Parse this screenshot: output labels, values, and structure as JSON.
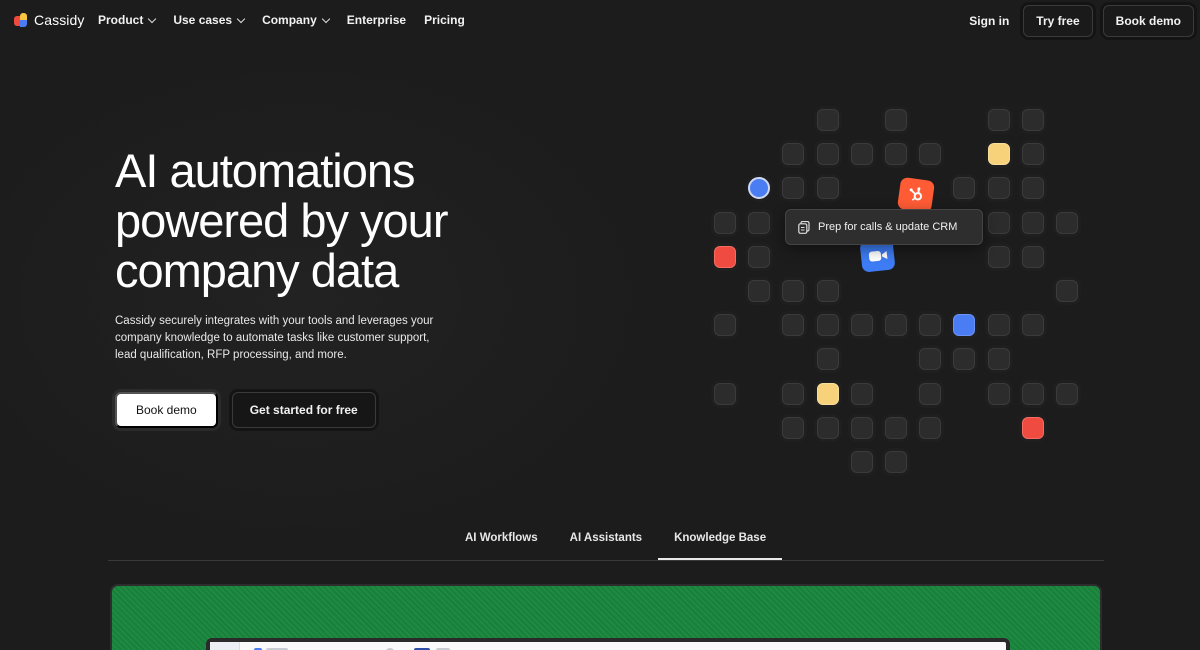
{
  "nav": {
    "brand": "Cassidy",
    "links": [
      {
        "label": "Product",
        "dropdown": true
      },
      {
        "label": "Use cases",
        "dropdown": true
      },
      {
        "label": "Company",
        "dropdown": true
      },
      {
        "label": "Enterprise",
        "dropdown": false
      },
      {
        "label": "Pricing",
        "dropdown": false
      }
    ],
    "sign_in": "Sign in",
    "try_free": "Try free",
    "book_demo": "Book demo"
  },
  "hero": {
    "title_line1": "AI automations",
    "title_line2": "powered by your",
    "title_line3": "company data",
    "description": "Cassidy securely integrates with your tools and leverages your company knowledge to automate tasks like customer support, lead qualification, RFP processing, and more.",
    "primary_cta": "Book demo",
    "secondary_cta": "Get started for free"
  },
  "illustration": {
    "tooltip": "Prep for calls & update CRM",
    "icons": [
      "hubspot-icon",
      "zoom-icon",
      "document-icon"
    ]
  },
  "tabs": [
    {
      "label": "AI Workflows",
      "active": false
    },
    {
      "label": "AI Assistants",
      "active": false
    },
    {
      "label": "Knowledge Base",
      "active": true
    }
  ],
  "colors": {
    "background": "#1c1c1c",
    "accent_blue": "#4a7cf4",
    "accent_yellow": "#f7d27a",
    "accent_red": "#ef4b40",
    "panel_green": "#1e8a43"
  }
}
